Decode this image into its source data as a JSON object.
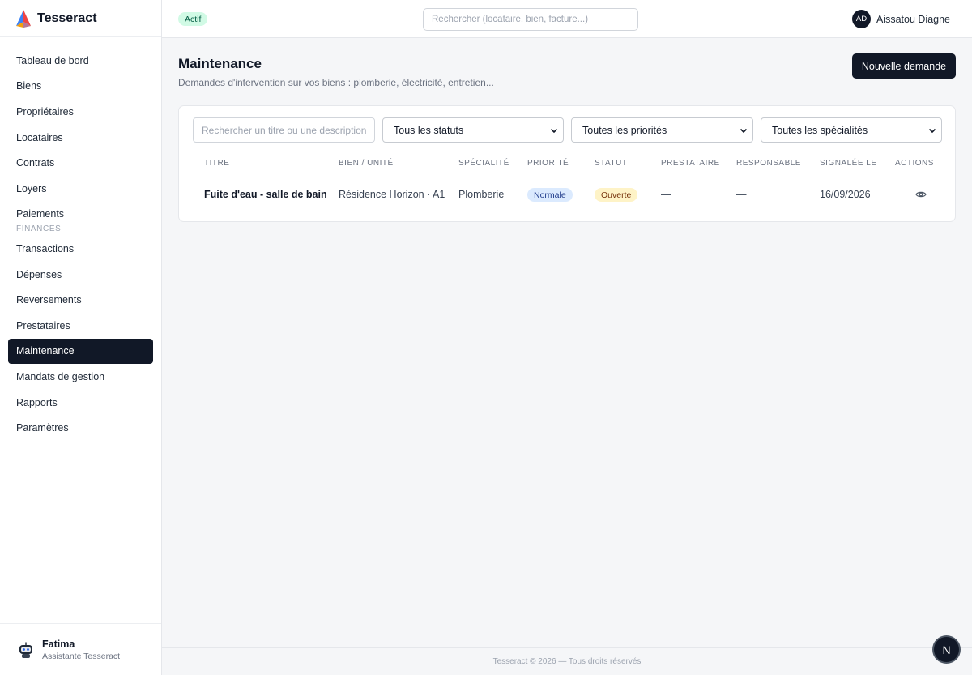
{
  "app": {
    "name": "Tesseract"
  },
  "sidebar": {
    "items": [
      {
        "label": "Tableau de bord"
      },
      {
        "label": "Biens"
      },
      {
        "label": "Propriétaires"
      },
      {
        "label": "Locataires"
      },
      {
        "label": "Contrats"
      },
      {
        "label": "Loyers"
      },
      {
        "label": "Paiements"
      }
    ],
    "section_label": "FINANCES",
    "finance_items": [
      {
        "label": "Transactions"
      },
      {
        "label": "Dépenses"
      },
      {
        "label": "Reversements"
      },
      {
        "label": "Prestataires"
      },
      {
        "label": "Maintenance",
        "active": true
      },
      {
        "label": "Mandats de gestion"
      },
      {
        "label": "Rapports"
      },
      {
        "label": "Paramètres"
      }
    ],
    "assistant": {
      "name": "Fatima",
      "role": "Assistante Tesseract"
    }
  },
  "topbar": {
    "status": "Actif",
    "search_placeholder": "Rechercher (locataire, bien, facture...)",
    "user": {
      "initials": "AD",
      "name": "Aissatou Diagne"
    }
  },
  "page": {
    "title": "Maintenance",
    "subtitle": "Demandes d'intervention sur vos biens : plomberie, électricité, entretien...",
    "new_button": "Nouvelle demande"
  },
  "filters": {
    "search_placeholder": "Rechercher un titre ou une description",
    "status": "Tous les statuts",
    "priority": "Toutes les priorités",
    "specialty": "Toutes les spécialités"
  },
  "table": {
    "headers": [
      "TITRE",
      "BIEN / UNITÉ",
      "SPÉCIALITÉ",
      "PRIORITÉ",
      "STATUT",
      "PRESTATAIRE",
      "RESPONSABLE",
      "SIGNALÉE LE",
      "ACTIONS"
    ],
    "rows": [
      {
        "title": "Fuite d'eau - salle de bain",
        "property": "Résidence Horizon · A1",
        "specialty": "Plomberie",
        "priority": "Normale",
        "status": "Ouverte",
        "provider": "—",
        "manager": "—",
        "reported": "16/09/2026",
        "action_icon": "eye-icon"
      }
    ]
  },
  "footer": {
    "text": "Tesseract © 2026 — Tous droits réservés"
  },
  "floating": {
    "label": "N"
  },
  "colors": {
    "primary": "#111827",
    "active_badge": "#d1fae5",
    "priority_badge": "#dbeafe",
    "status_badge": "#fef3c7"
  }
}
